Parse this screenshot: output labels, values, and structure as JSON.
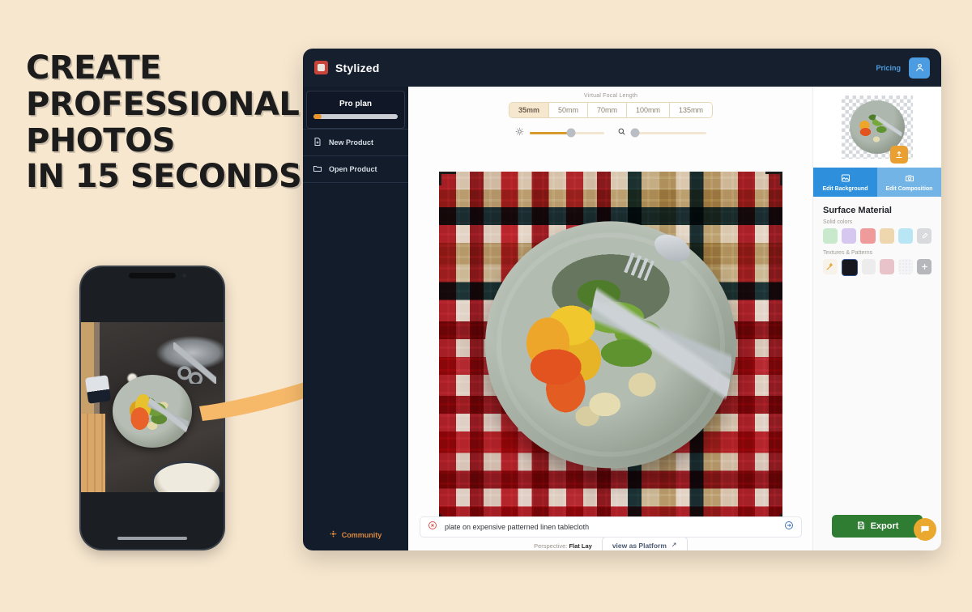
{
  "promo": {
    "headline_lines": [
      "Create",
      "Professional",
      "Photos",
      "in 15 seconds"
    ],
    "background_color": "#f7e7cf"
  },
  "app": {
    "topbar": {
      "brand_name": "Stylized",
      "logo_icon": "app-logo-icon",
      "pricing_label": "Pricing",
      "account_icon": "user-avatar-icon"
    },
    "sidebar": {
      "plan": {
        "name": "Pro plan",
        "usage_percent": 10
      },
      "items": [
        {
          "label": "New Product",
          "icon": "new-document-icon"
        },
        {
          "label": "Open Product",
          "icon": "folder-icon"
        }
      ],
      "community": {
        "label": "Community",
        "icon": "community-icon"
      }
    },
    "toolbar": {
      "focal_label": "Virtual Focal Length",
      "focal_options": [
        "35mm",
        "50mm",
        "70mm",
        "100mm",
        "135mm"
      ],
      "focal_selected": "35mm",
      "sliders": [
        {
          "icon": "brightness-icon",
          "value_percent": 55
        },
        {
          "icon": "zoom-icon",
          "value_percent": 3
        }
      ]
    },
    "canvas": {
      "perspective_label": "Perspective:",
      "perspective_value": "Flat Lay",
      "platform_button": "view as Platform",
      "platform_icon": "external-link-icon"
    },
    "prompt": {
      "clear_icon": "clear-circle-icon",
      "value": "plate on expensive patterned linen tablecloth",
      "submit_icon": "submit-arrow-icon"
    },
    "right_panel": {
      "upload_icon": "upload-icon",
      "tabs": [
        {
          "label": "Edit Background",
          "icon": "image-icon",
          "active": true
        },
        {
          "label": "Edit Composition",
          "icon": "camera-icon",
          "active": false
        }
      ],
      "surface_material_title": "Surface Material",
      "solid_colors_label": "Solid colors",
      "solid_colors": [
        "#c9e9cd",
        "#d6c7f0",
        "#ef9b9b",
        "#eed6ae",
        "#b9e6f5"
      ],
      "eyedropper_icon": "eyedropper-icon",
      "textures_label": "Textures & Patterns",
      "textures": [
        "#f2e2c4",
        "#17181f",
        "#ececec",
        "#e8c3ca",
        "#f4f4f6"
      ],
      "magic_icon": "magic-wand-icon",
      "add_icon": "plus-icon"
    },
    "footer": {
      "export_label": "Export",
      "export_icon": "save-icon",
      "export_color": "#2e7d32",
      "chat_icon": "chat-bubble-icon"
    }
  }
}
